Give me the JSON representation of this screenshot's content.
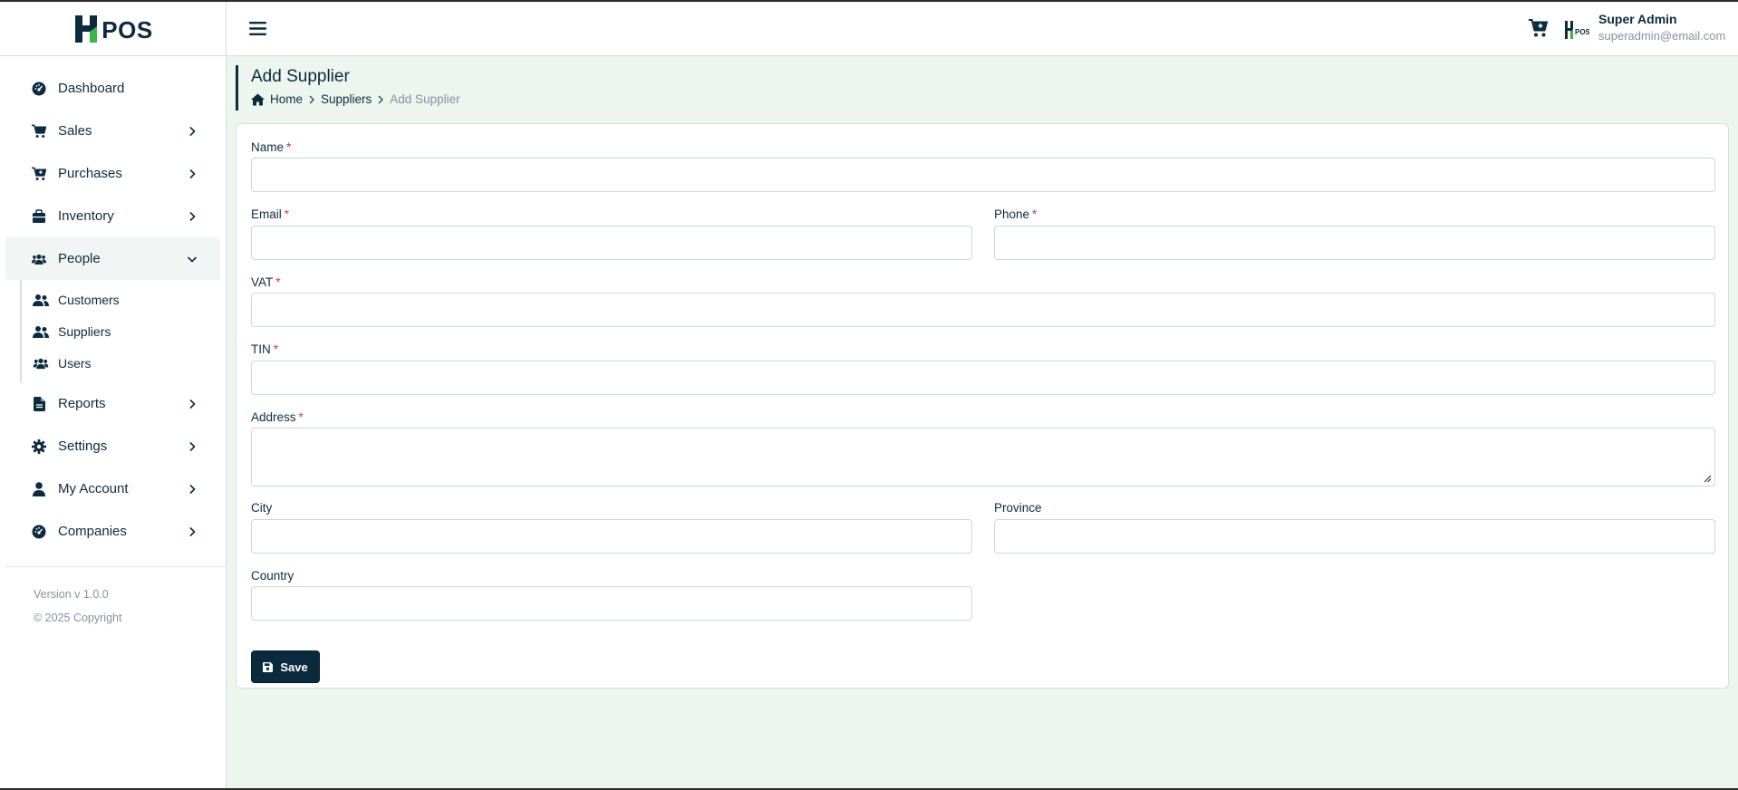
{
  "brand": {
    "logo_text": "POS",
    "accent_dark": "#0d2b3e",
    "accent_green": "#3bb54a"
  },
  "sidebar": {
    "items": [
      {
        "label": "Dashboard",
        "icon": "dashboard-icon",
        "expandable": false
      },
      {
        "label": "Sales",
        "icon": "cart-icon",
        "expandable": true
      },
      {
        "label": "Purchases",
        "icon": "cart-plus-icon",
        "expandable": true
      },
      {
        "label": "Inventory",
        "icon": "box-icon",
        "expandable": true
      },
      {
        "label": "People",
        "icon": "users-icon",
        "expandable": true,
        "open": true
      },
      {
        "label": "Reports",
        "icon": "file-icon",
        "expandable": true
      },
      {
        "label": "Settings",
        "icon": "gear-icon",
        "expandable": true
      },
      {
        "label": "My Account",
        "icon": "user-icon",
        "expandable": true
      },
      {
        "label": "Companies",
        "icon": "dashboard-icon",
        "expandable": true
      }
    ],
    "people_sub": [
      {
        "label": "Customers",
        "icon": "user-group-icon"
      },
      {
        "label": "Suppliers",
        "icon": "user-group-icon"
      },
      {
        "label": "Users",
        "icon": "users-icon"
      }
    ],
    "footer": {
      "version": "Version v 1.0.0",
      "copyright": "© 2025 Copyright"
    }
  },
  "topbar": {
    "user_name": "Super Admin",
    "user_email": "superadmin@email.com"
  },
  "page": {
    "title": "Add Supplier",
    "breadcrumb": [
      "Home",
      "Suppliers",
      "Add Supplier"
    ]
  },
  "form": {
    "name_label": "Name",
    "email_label": "Email",
    "phone_label": "Phone",
    "vat_label": "VAT",
    "tin_label": "TIN",
    "address_label": "Address",
    "city_label": "City",
    "province_label": "Province",
    "country_label": "Country",
    "required_mark": "*",
    "values": {
      "name": "",
      "email": "",
      "phone": "",
      "vat": "",
      "tin": "",
      "address": "",
      "city": "",
      "province": "",
      "country": ""
    },
    "save_label": "Save"
  }
}
